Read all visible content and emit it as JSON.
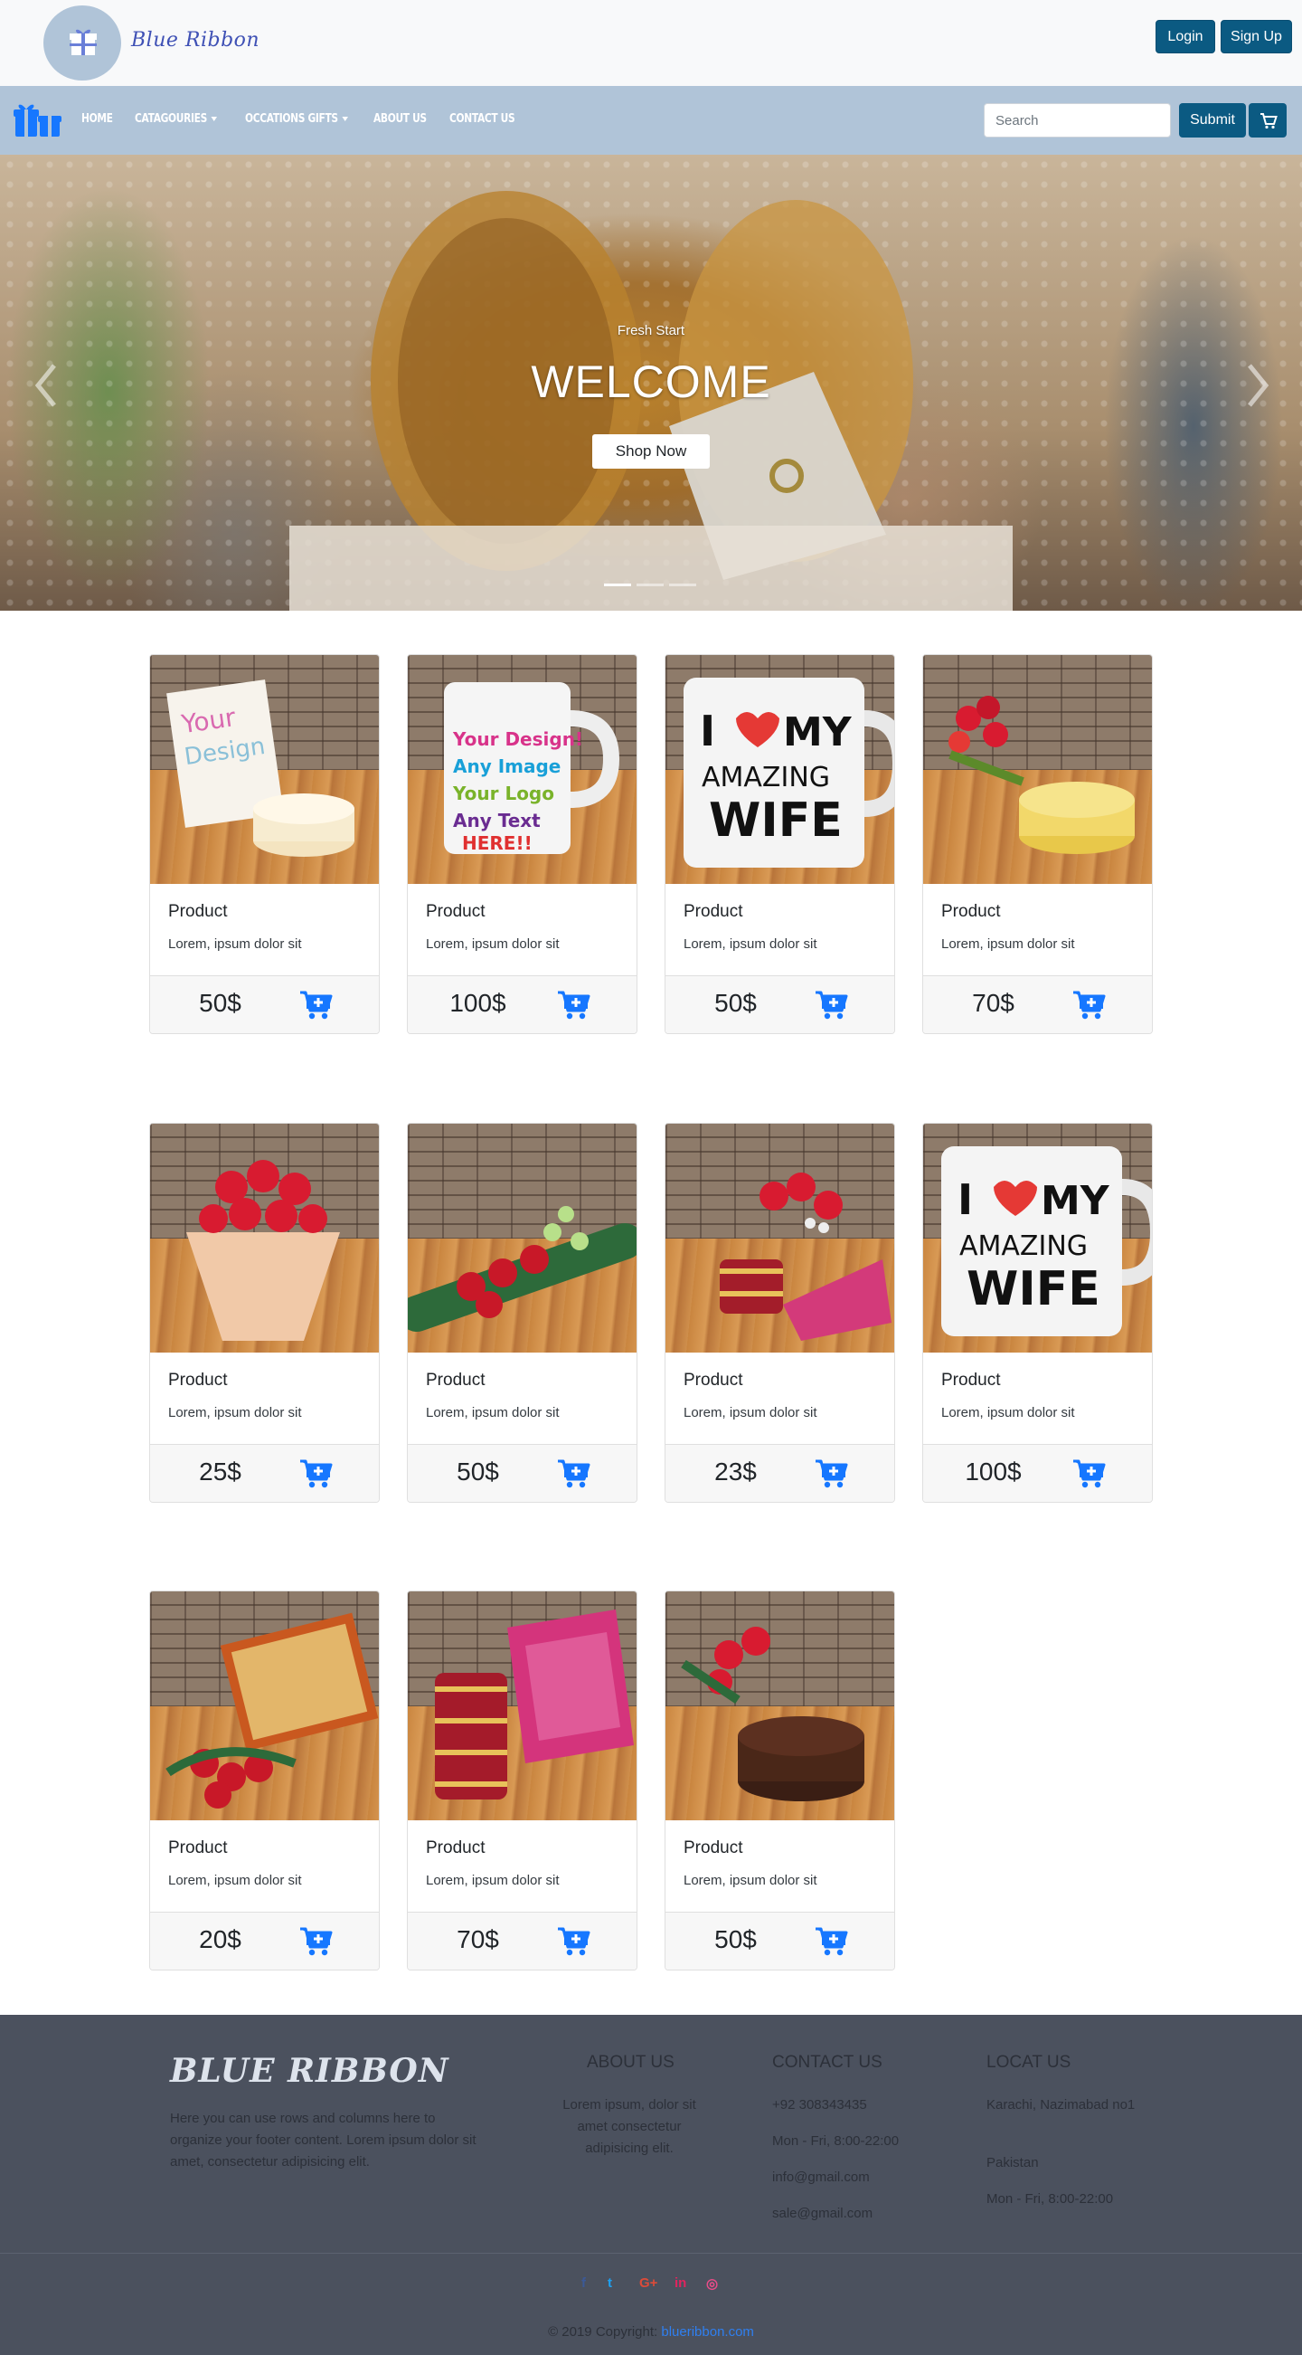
{
  "header": {
    "brand": "Blue Ribbon",
    "login_label": "Login",
    "signup_label": "Sign Up"
  },
  "nav": {
    "items": [
      {
        "label": "Home",
        "dropdown": false
      },
      {
        "label": "Catagouries",
        "dropdown": true
      },
      {
        "label": "Occations Gifts",
        "dropdown": true
      },
      {
        "label": "About Us",
        "dropdown": false
      },
      {
        "label": "Contact Us",
        "dropdown": false
      }
    ],
    "search_placeholder": "Search",
    "search_value": "",
    "submit_label": "Submit",
    "cart_icon": "cart-icon"
  },
  "hero": {
    "tagline": "Fresh Start",
    "title": "WELCOME",
    "button_label": "Shop Now",
    "slides": 3,
    "active_slide": 1
  },
  "products": [
    {
      "title": "Product",
      "text": "Lorem, ipsum dolor sit",
      "price": "50$",
      "item": "card-and-cake"
    },
    {
      "title": "Product",
      "text": "Lorem, ipsum dolor sit",
      "price": "100$",
      "item": "custom-mug"
    },
    {
      "title": "Product",
      "text": "Lorem, ipsum dolor sit",
      "price": "50$",
      "item": "wife-mug"
    },
    {
      "title": "Product",
      "text": "Lorem, ipsum dolor sit",
      "price": "70$",
      "item": "roses-and-cake"
    },
    {
      "title": "Product",
      "text": "Lorem, ipsum dolor sit",
      "price": "25$",
      "item": "rose-bouquet"
    },
    {
      "title": "Product",
      "text": "Lorem, ipsum dolor sit",
      "price": "50$",
      "item": "mixed-bouquet"
    },
    {
      "title": "Product",
      "text": "Lorem, ipsum dolor sit",
      "price": "23$",
      "item": "bangles-and-roses"
    },
    {
      "title": "Product",
      "text": "Lorem, ipsum dolor sit",
      "price": "100$",
      "item": "wife-mug"
    },
    {
      "title": "Product",
      "text": "Lorem, ipsum dolor sit",
      "price": "20$",
      "item": "sweets-and-roses"
    },
    {
      "title": "Product",
      "text": "Lorem, ipsum dolor sit",
      "price": "70$",
      "item": "bangles-set"
    },
    {
      "title": "Product",
      "text": "Lorem, ipsum dolor sit",
      "price": "50$",
      "item": "roses-and-chocolate-cake"
    }
  ],
  "footer": {
    "brand": "BLUE RIBBON",
    "description": "Here you can use rows and columns here to organize your footer content. Lorem ipsum dolor sit amet, consectetur adipisicing elit.",
    "about": {
      "heading": "ABOUT US",
      "text": "Lorem ipsum, dolor sit amet consectetur adipisicing elit."
    },
    "contact": {
      "heading": "CONTACT US",
      "phone": "+92 308343435",
      "hours": "Mon - Fri, 8:00-22:00",
      "email1": "info@gmail.com",
      "email2": "sale@gmail.com"
    },
    "locate": {
      "heading": "LOCAT US",
      "address": "Karachi, Nazimabad no1",
      "country": "Pakistan",
      "hours": "Mon - Fri, 8:00-22:00"
    },
    "social": [
      {
        "glyph": "f",
        "name": "facebook-icon",
        "color": "#3b5998"
      },
      {
        "glyph": "t",
        "name": "twitter-icon",
        "color": "#1da1f2"
      },
      {
        "glyph": "G+",
        "name": "google-plus-icon",
        "color": "#dd4b39"
      },
      {
        "glyph": "in",
        "name": "linkedin-icon",
        "color": "#e0245e"
      },
      {
        "glyph": "◎",
        "name": "dribbble-icon",
        "color": "#ea4c89"
      }
    ],
    "copyright": "© 2019 Copyright:",
    "copyright_link": "blueribbon.com"
  },
  "colors": {
    "brand_blue": "#3f51b5",
    "button_dark": "#0b5a82",
    "nav_bg": "#b0c4d8",
    "cart_blue": "#1677ff",
    "footer_bg": "#4b515e"
  }
}
